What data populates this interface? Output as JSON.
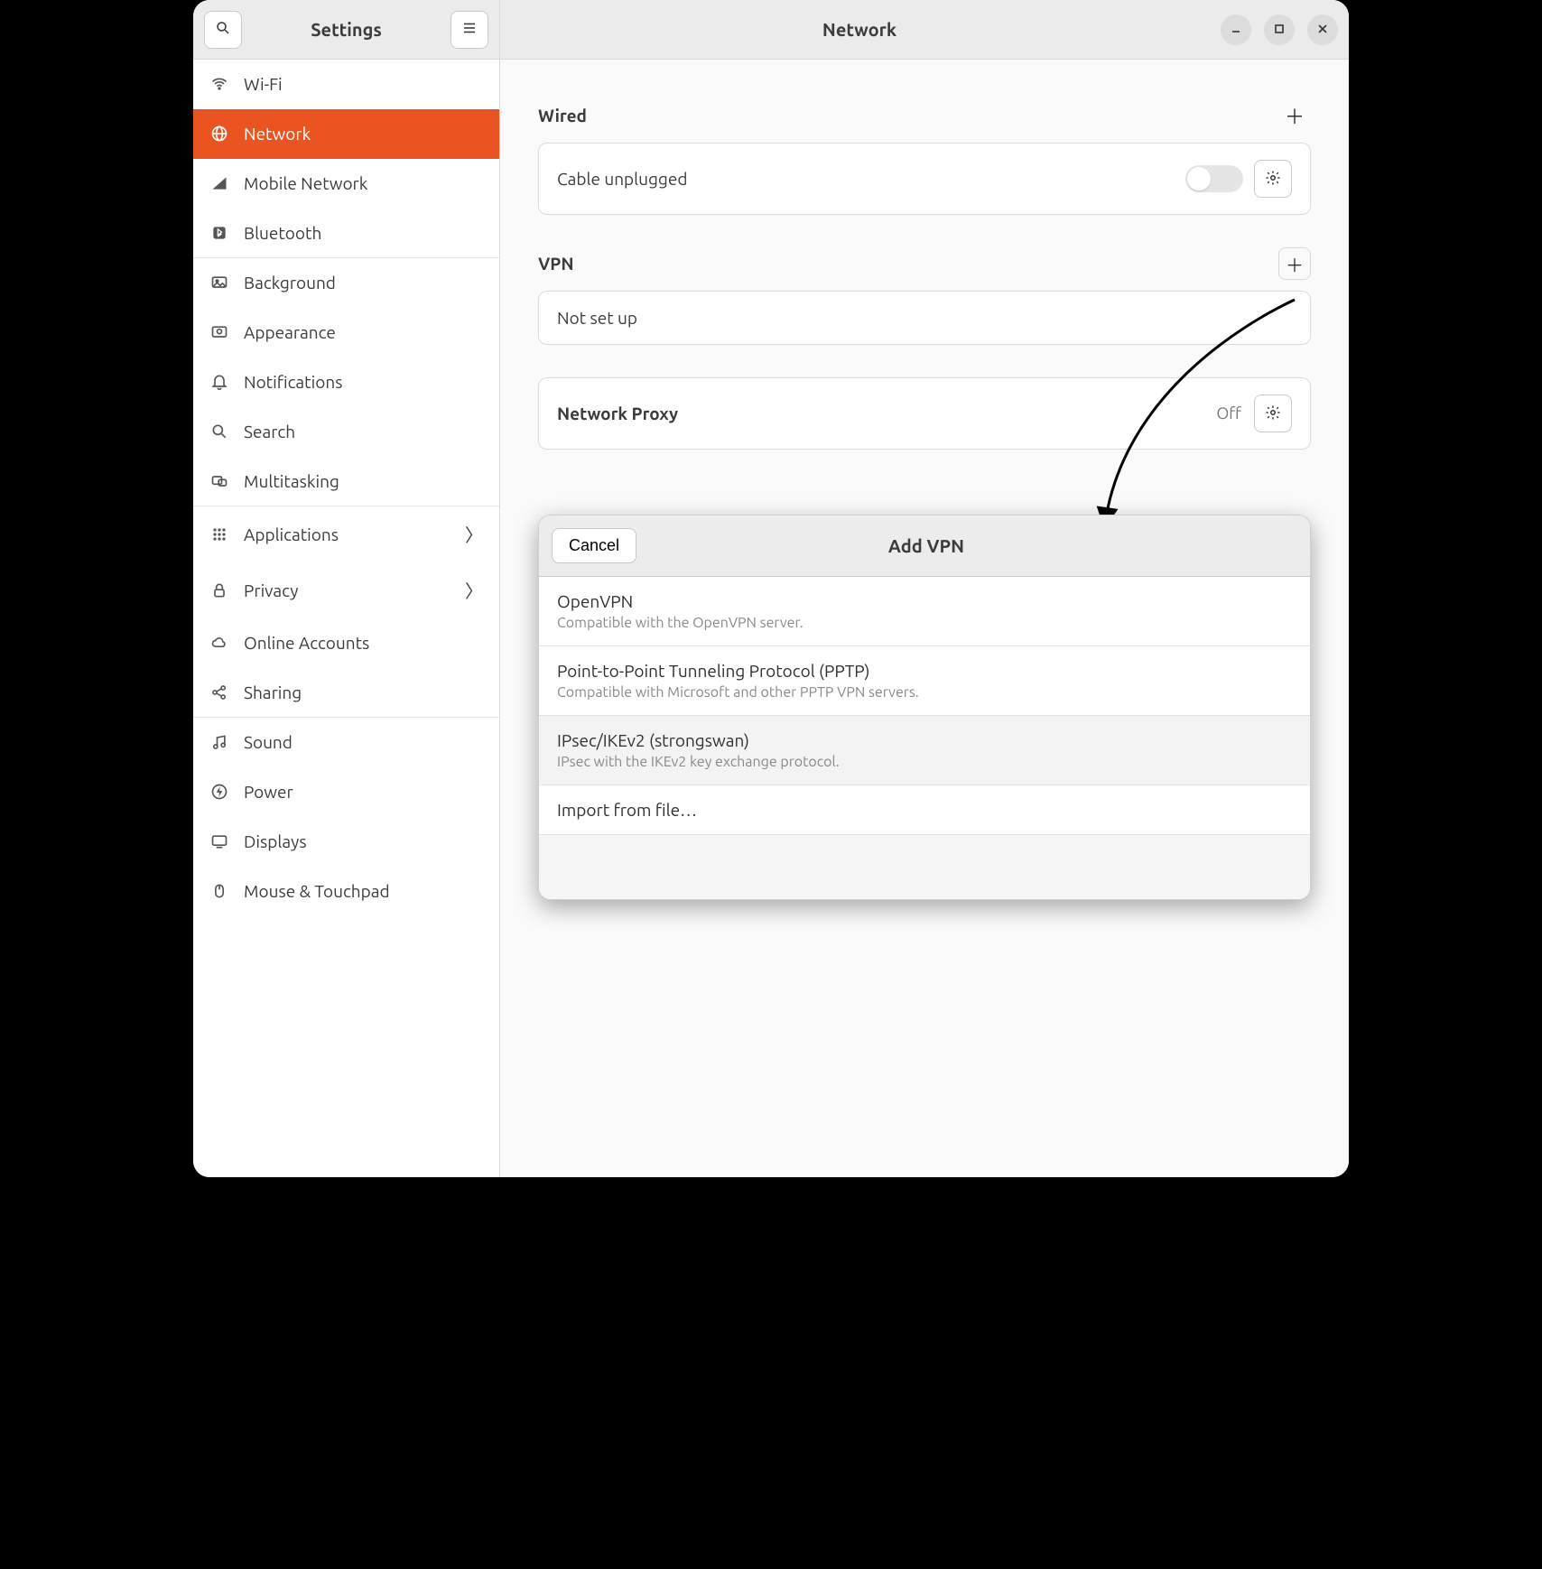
{
  "sidebar": {
    "title": "Settings",
    "items": [
      {
        "label": "Wi-Fi"
      },
      {
        "label": "Network"
      },
      {
        "label": "Mobile Network"
      },
      {
        "label": "Bluetooth"
      },
      {
        "label": "Background"
      },
      {
        "label": "Appearance"
      },
      {
        "label": "Notifications"
      },
      {
        "label": "Search"
      },
      {
        "label": "Multitasking"
      },
      {
        "label": "Applications"
      },
      {
        "label": "Privacy"
      },
      {
        "label": "Online Accounts"
      },
      {
        "label": "Sharing"
      },
      {
        "label": "Sound"
      },
      {
        "label": "Power"
      },
      {
        "label": "Displays"
      },
      {
        "label": "Mouse & Touchpad"
      }
    ]
  },
  "main": {
    "title": "Network",
    "wired": {
      "heading": "Wired",
      "status": "Cable unplugged"
    },
    "vpn": {
      "heading": "VPN",
      "status": "Not set up"
    },
    "proxy": {
      "heading": "Network Proxy",
      "status": "Off"
    }
  },
  "dialog": {
    "cancel": "Cancel",
    "title": "Add VPN",
    "options": [
      {
        "title": "OpenVPN",
        "desc": "Compatible with the OpenVPN server."
      },
      {
        "title": "Point-to-Point Tunneling Protocol (PPTP)",
        "desc": "Compatible with Microsoft and other PPTP VPN servers."
      },
      {
        "title": "IPsec/IKEv2 (strongswan)",
        "desc": "IPsec with the IKEv2 key exchange protocol."
      },
      {
        "title": "Import from file…",
        "desc": ""
      }
    ]
  }
}
